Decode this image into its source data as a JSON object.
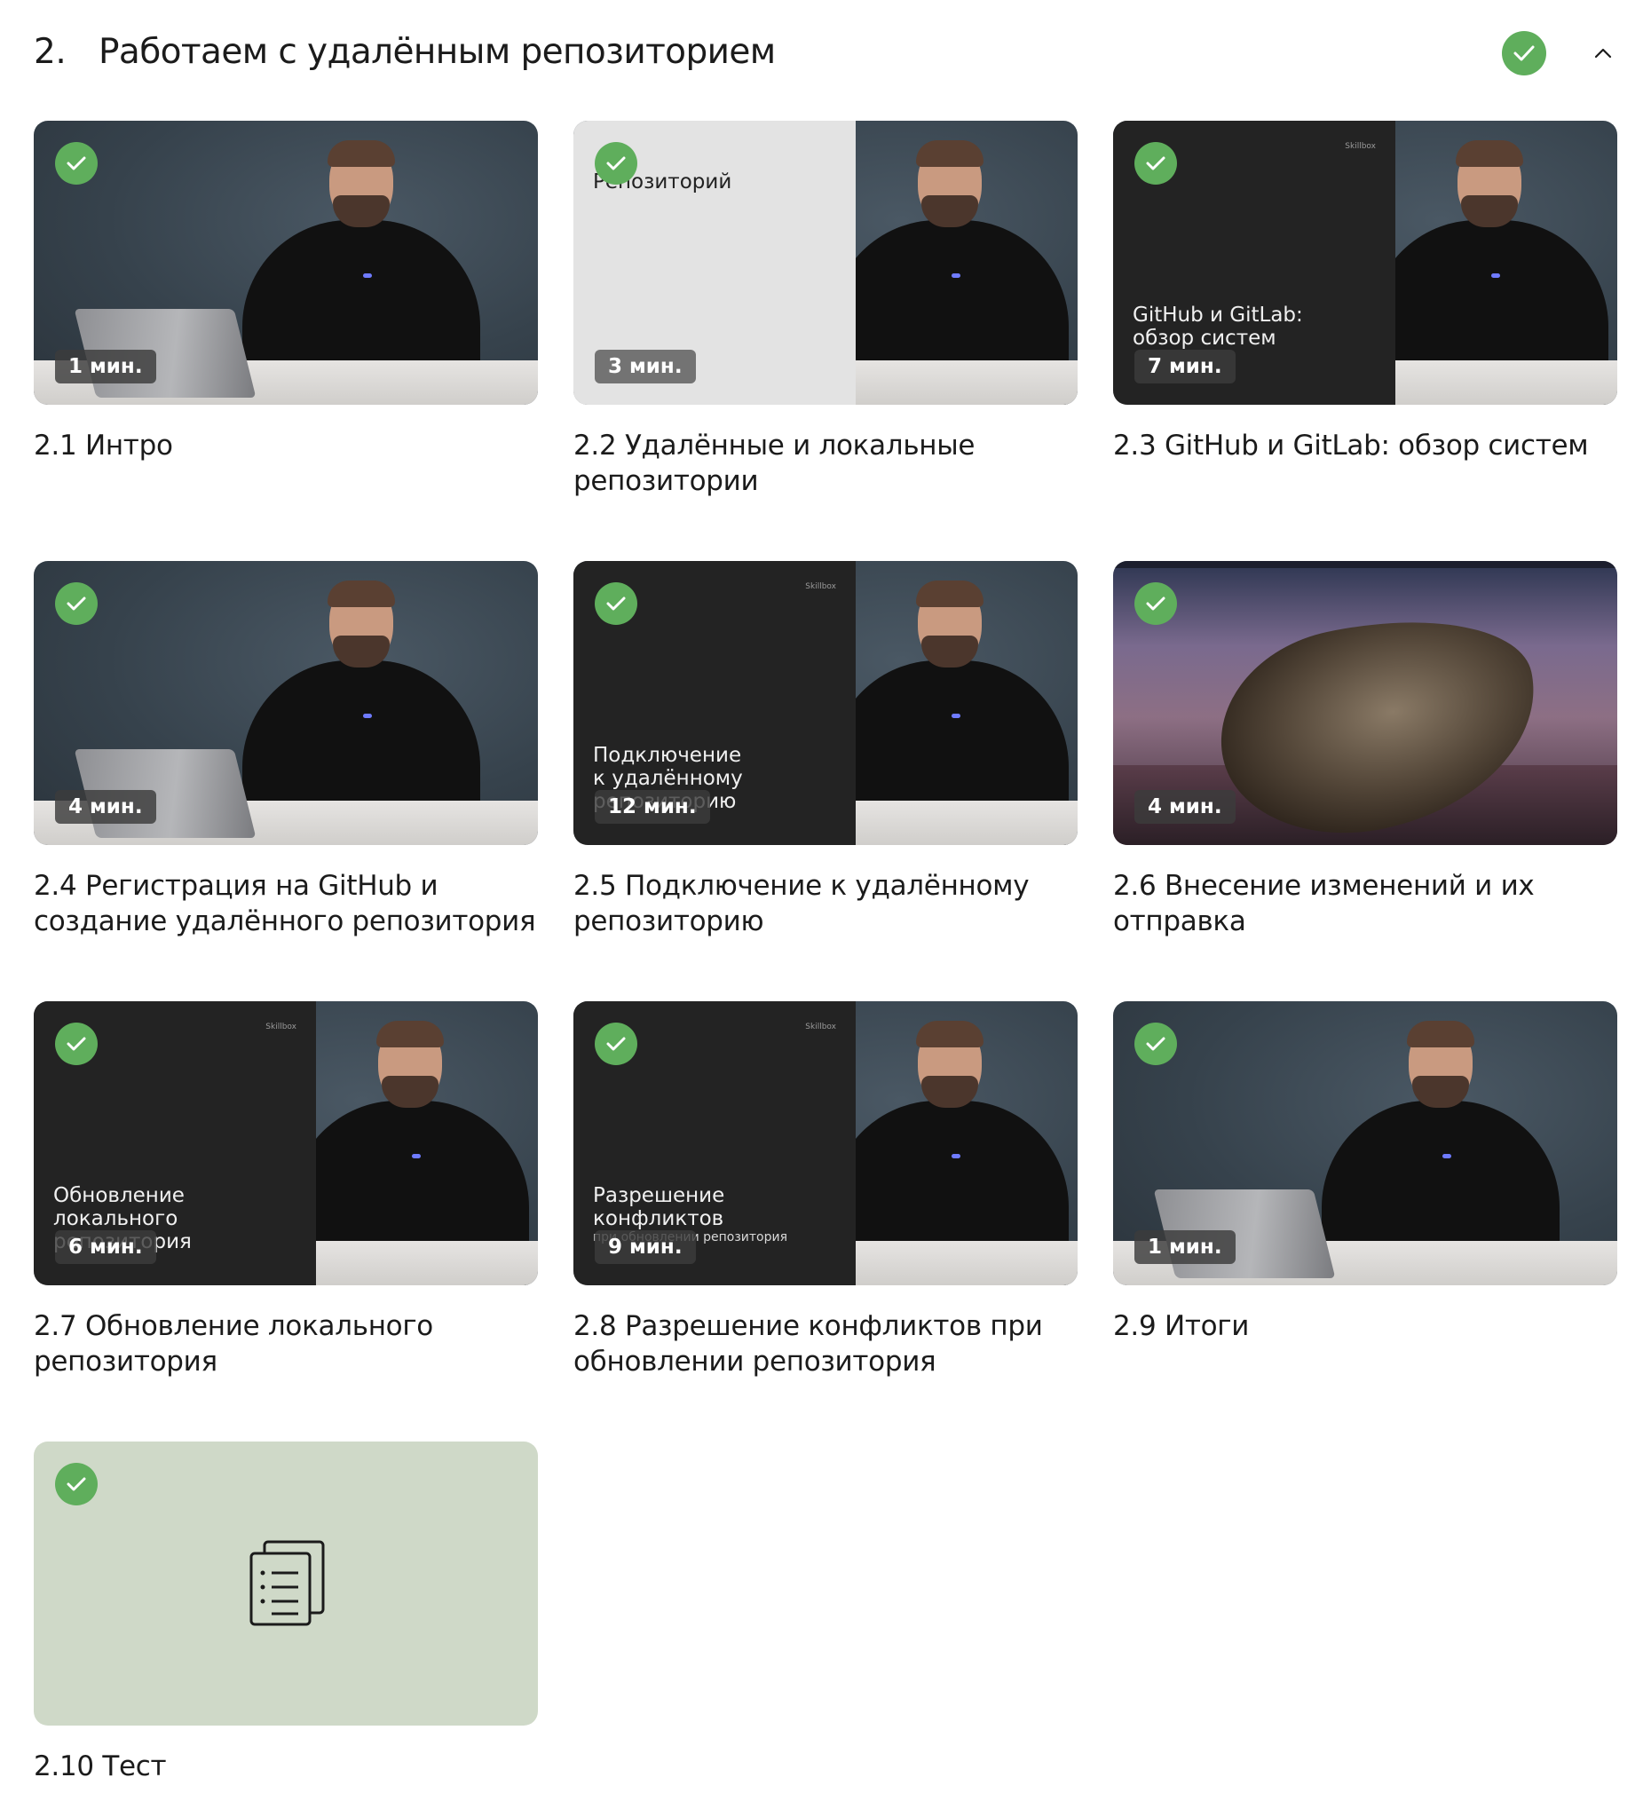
{
  "section": {
    "number": "2.",
    "title": "Работаем с удалённым репозиторием"
  },
  "lessons": [
    {
      "title": "2.1 Интро",
      "duration": "1 мин.",
      "completed": true,
      "thumb": "studio"
    },
    {
      "title": "2.2 Удалённые и локальные репозитории",
      "duration": "3 мин.",
      "completed": true,
      "thumb": "slide-light",
      "slide_text": "Репозиторий"
    },
    {
      "title": "2.3 GitHub и GitLab: обзор систем",
      "duration": "7 мин.",
      "completed": true,
      "thumb": "slide-dark",
      "slide_text": "GitHub и GitLab: обзор систем",
      "brand": "Skillbox"
    },
    {
      "title": "2.4 Регистрация на GitHub и создание удалённого репозитория",
      "duration": "4 мин.",
      "completed": true,
      "thumb": "studio"
    },
    {
      "title": "2.5 Подключение к удалённому репозиторию",
      "duration": "12 мин.",
      "completed": true,
      "thumb": "slide-dark",
      "slide_text": "Подключение к удалённому репозиторию",
      "brand": "Skillbox"
    },
    {
      "title": "2.6 Внесение изменений и их отправка",
      "duration": "4 мин.",
      "completed": true,
      "thumb": "desktop"
    },
    {
      "title": "2.7 Обновление локального репозитория",
      "duration": "6 мин.",
      "completed": true,
      "thumb": "slide-dark",
      "slide_text": "Обновление локального репозитория",
      "brand": "Skillbox"
    },
    {
      "title": "2.8 Разрешение конфликтов при обновлении репозитория",
      "duration": "9 мин.",
      "completed": true,
      "thumb": "slide-dark",
      "slide_text": "Разрешение конфликтов",
      "slide_sub": "при обновлении репозитория",
      "brand": "Skillbox"
    },
    {
      "title": "2.9 Итоги",
      "duration": "1 мин.",
      "completed": true,
      "thumb": "studio"
    },
    {
      "title": "2.10 Тест",
      "completed": true,
      "thumb": "test",
      "icon": "test-document-icon"
    }
  ],
  "colors": {
    "check_green": "#5fae5c",
    "test_bg": "#cfd9c8"
  }
}
